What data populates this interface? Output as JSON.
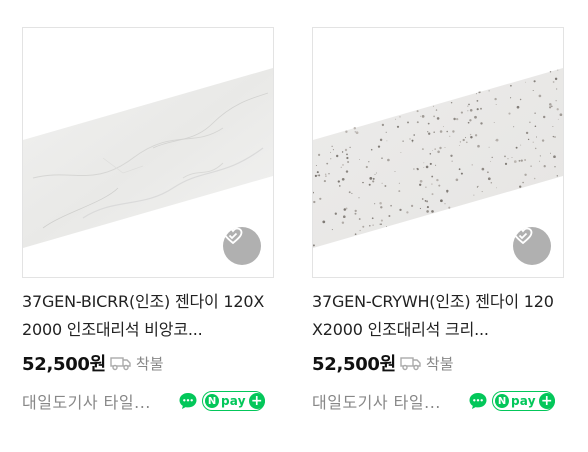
{
  "products": [
    {
      "title": "37GEN-BICRR(인조) 젠다이 120X2000 인조대리석 비앙코...",
      "price": "52,500원",
      "shipping": "착불",
      "seller": "대일도기사 타일...",
      "pay_label": "pay",
      "pay_n": "N",
      "pay_plus": "+",
      "image_style": "white marble"
    },
    {
      "title": "37GEN-CRYWH(인조) 젠다이 120X2000 인조대리석 크리...",
      "price": "52,500원",
      "shipping": "착불",
      "seller": "대일도기사 타일...",
      "pay_label": "pay",
      "pay_n": "N",
      "pay_plus": "+",
      "image_style": "speckled quartz"
    }
  ],
  "colors": {
    "npay_green": "#03c75a",
    "wish_bg": "#969696",
    "muted_text": "#888888"
  },
  "icons": [
    "heart-check-icon",
    "truck-icon",
    "talk-bubble-icon",
    "npay-plus-icon"
  ]
}
